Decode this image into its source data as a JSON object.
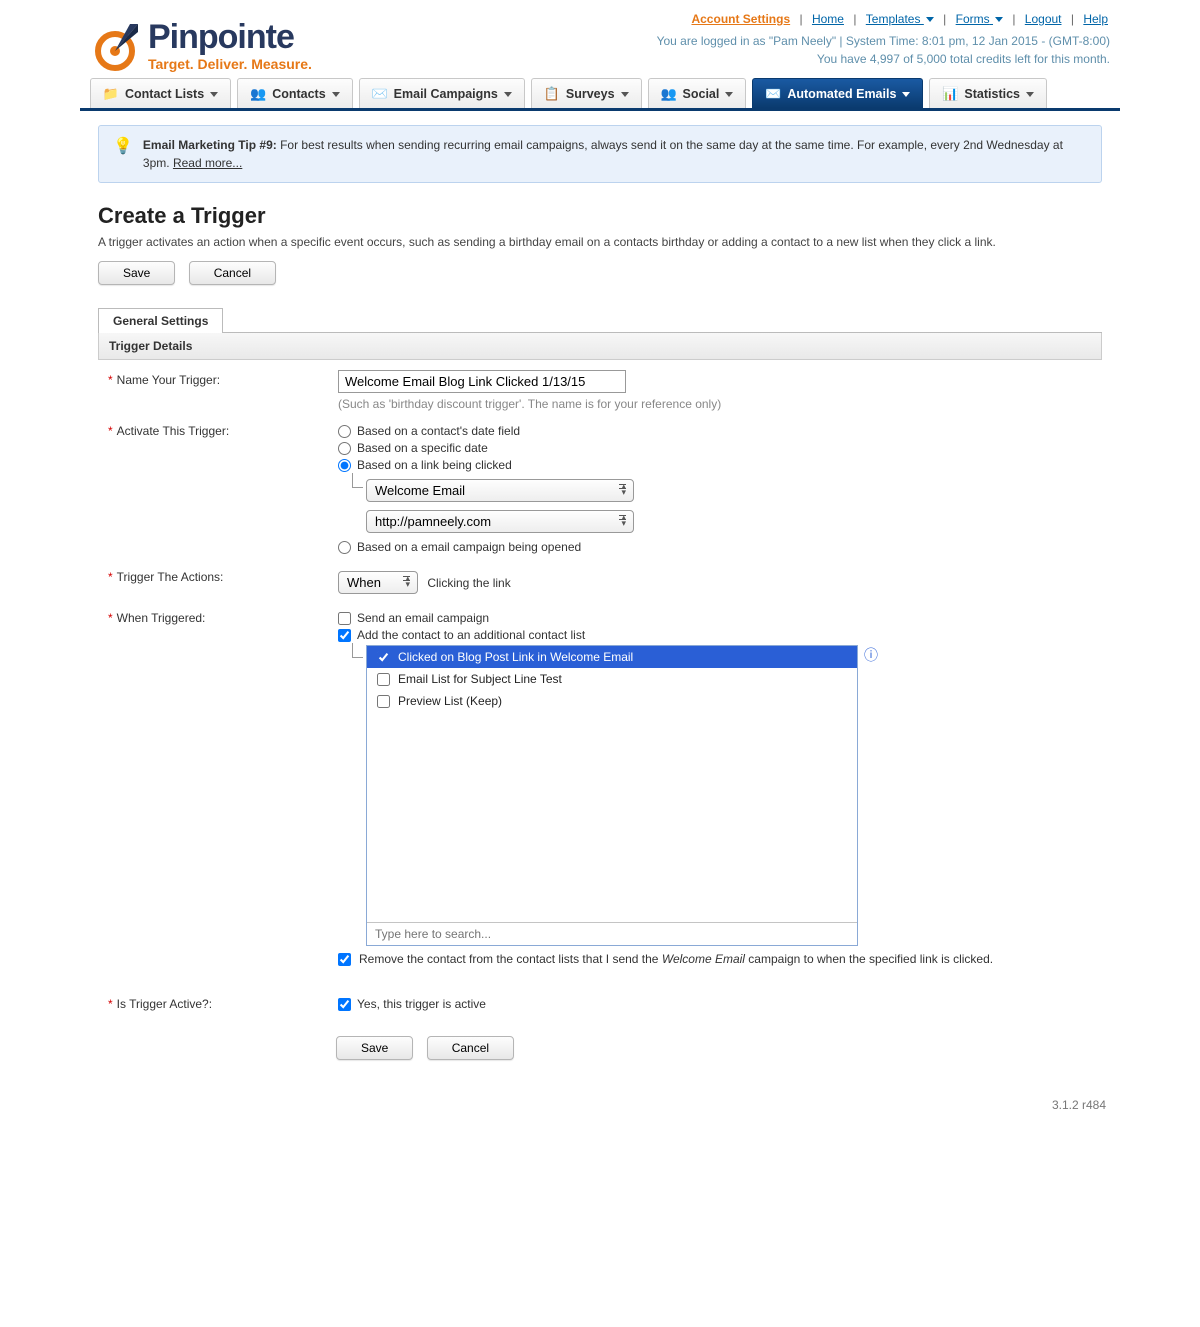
{
  "topnav": {
    "account_settings": "Account Settings",
    "home": "Home",
    "templates": "Templates",
    "forms": "Forms",
    "logout": "Logout",
    "help": "Help"
  },
  "meta": {
    "line1": "You are logged in as \"Pam Neely\" | System Time: 8:01 pm, 12 Jan 2015 - (GMT-8:00)",
    "line2": "You have 4,997 of 5,000 total credits left for this month."
  },
  "logo": {
    "name": "Pinpointe",
    "tag": "Target. Deliver. Measure."
  },
  "mainnav": {
    "contact_lists": "Contact Lists",
    "contacts": "Contacts",
    "email_campaigns": "Email Campaigns",
    "surveys": "Surveys",
    "social": "Social",
    "automated_emails": "Automated Emails",
    "statistics": "Statistics"
  },
  "tip": {
    "title": "Email Marketing Tip #9:",
    "body": " For best results when sending recurring email campaigns, always send it on the same day at the same time. For example, every 2nd Wednesday at 3pm. ",
    "readmore": "Read more..."
  },
  "page": {
    "title": "Create a Trigger",
    "desc": "A trigger activates an action when a specific event occurs, such as sending a birthday email on a contacts birthday or adding a contact to a new list when they click a link.",
    "save": "Save",
    "cancel": "Cancel",
    "tab_general": "General Settings",
    "section_trigger": "Trigger Details"
  },
  "form": {
    "name_label": "Name Your Trigger:",
    "name_value": "Welcome Email Blog Link Clicked 1/13/15",
    "name_hint": "(Such as 'birthday discount trigger'. The name is for your reference only)",
    "activate_label": "Activate This Trigger:",
    "radio_date_field": "Based on a contact's date field",
    "radio_specific_date": "Based on a specific date",
    "radio_link_clicked": "Based on a link being clicked",
    "radio_campaign_opened": "Based on a email campaign being opened",
    "sel_campaign": "Welcome Email",
    "sel_link": "http://pamneely.com",
    "trigger_actions_label": "Trigger The Actions:",
    "when_sel": "When",
    "when_text": "Clicking the link",
    "when_triggered_label": "When Triggered:",
    "chk_send_campaign": "Send an email campaign",
    "chk_add_list": "Add the contact to an additional contact list",
    "list_opt1": "Clicked on Blog Post Link in Welcome Email",
    "list_opt2": "Email List for Subject Line Test",
    "list_opt3": "Preview List (Keep)",
    "search_placeholder": "Type here to search...",
    "remove_pre": "Remove the contact from the contact lists that I send the ",
    "remove_em": "Welcome Email",
    "remove_post": " campaign to when the specified link is clicked.",
    "active_label": "Is Trigger Active?:",
    "active_text": "Yes, this trigger is active"
  },
  "footer": {
    "version": "3.1.2 r484"
  }
}
